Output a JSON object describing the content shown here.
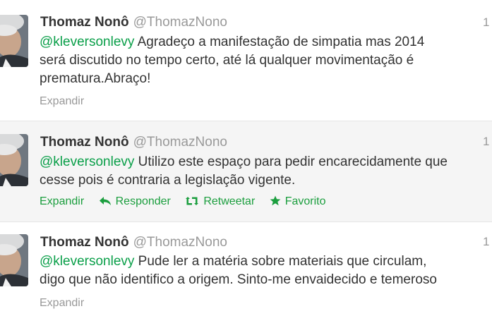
{
  "tweets": [
    {
      "name": "Thomaz Nonô",
      "handle": "@ThomazNono",
      "time": "1",
      "mention": "@kleversonlevy",
      "line1_rest": " Agradeço a manifestação de simpatia mas 2014",
      "line2": "será discutido no tempo certo, até lá qualquer movimentação é",
      "line3": "prematura.Abraço!",
      "expand_label": "Expandir"
    },
    {
      "name": "Thomaz Nonô",
      "handle": "@ThomazNono",
      "time": "1",
      "mention": "@kleversonlevy",
      "line1_rest": " Utilizo este espaço para pedir encarecidamente que",
      "line2": "cesse pois é contraria a legislação vigente.",
      "expand_label": "Expandir",
      "reply_label": "Responder",
      "retweet_label": "Retweetar",
      "favorite_label": "Favorito"
    },
    {
      "name": "Thomaz Nonô",
      "handle": "@ThomazNono",
      "time": "1",
      "mention": "@kleversonlevy",
      "line1_rest": " Pude ler a matéria sobre materiais que circulam,",
      "line2": "digo que não identifico a origem. Sinto-me envaidecido e temeroso",
      "expand_label": "Expandir"
    }
  ],
  "icons": {
    "reply": "reply-arrow-icon",
    "retweet": "retweet-icon",
    "favorite": "star-icon"
  },
  "colors": {
    "mention": "#0a9f49",
    "action": "#1b9e3e",
    "name": "#333333",
    "muted": "#999999",
    "hover_row": "#f5f5f5"
  }
}
